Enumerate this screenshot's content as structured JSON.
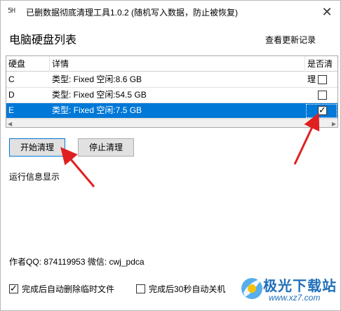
{
  "window": {
    "title": "已删数据彻底清理工具1.0.2 (随机写入数据，防止被恢复)",
    "icon_text": "5H",
    "close_glyph": "✕"
  },
  "header": {
    "heading": "电脑硬盘列表",
    "changelog_link": "查看更新记录"
  },
  "table": {
    "columns": [
      "硬盘",
      "详情",
      "是否清理"
    ],
    "rows": [
      {
        "drive": "C",
        "detail": "类型: Fixed 空闲:8.6 GB",
        "checked": false,
        "selected": false
      },
      {
        "drive": "D",
        "detail": "类型: Fixed 空闲:54.5 GB",
        "checked": false,
        "selected": false
      },
      {
        "drive": "E",
        "detail": "类型: Fixed 空闲:7.5 GB",
        "checked": true,
        "selected": true
      }
    ],
    "scroll_left_glyph": "◀",
    "scroll_right_glyph": "▶"
  },
  "buttons": {
    "start": "开始清理",
    "stop": "停止清理"
  },
  "info": {
    "label": "运行信息显示"
  },
  "footer": {
    "author": "作者QQ: 874119953  微信: cwj_pdca",
    "options": [
      {
        "label": "完成后自动删除临时文件",
        "checked": true
      },
      {
        "label": "完成后30秒自动关机",
        "checked": false
      }
    ]
  },
  "watermark": {
    "text": "极光下载站",
    "url": "www.xz7.com"
  },
  "colors": {
    "selection": "#0078d7",
    "annotation_arrow": "#e02020",
    "watermark": "#1f6fb8"
  }
}
